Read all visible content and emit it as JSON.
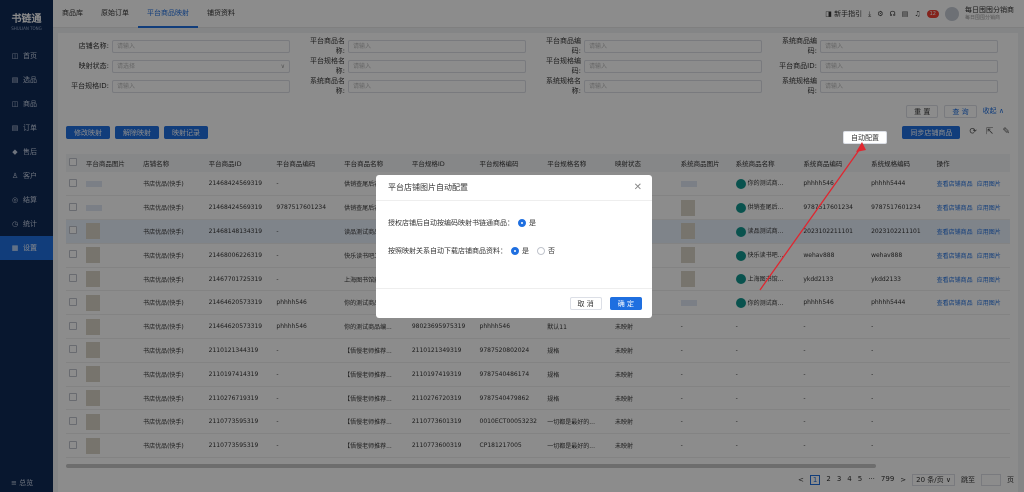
{
  "app": {
    "name": "书链通",
    "sub": "SHULIAN TONG"
  },
  "sidebar": {
    "items": [
      {
        "icon": "◫",
        "label": "首页"
      },
      {
        "icon": "▤",
        "label": "选品"
      },
      {
        "icon": "◫",
        "label": "商品"
      },
      {
        "icon": "▤",
        "label": "订单"
      },
      {
        "icon": "◆",
        "label": "售后"
      },
      {
        "icon": "♙",
        "label": "客户"
      },
      {
        "icon": "◎",
        "label": "结算"
      },
      {
        "icon": "◷",
        "label": "统计"
      },
      {
        "icon": "▦",
        "label": "设置"
      }
    ],
    "footer": "≡ 总览"
  },
  "topnav": {
    "tabs": [
      "商品库",
      "原始订单",
      "平台商品映射",
      "铺货资料"
    ]
  },
  "topright": {
    "guide": "新手指引",
    "badge": "12",
    "user_line1": "每日囤囤分销商",
    "user_line2": "每日囤囤分销商"
  },
  "filters": {
    "rows": [
      [
        {
          "label": "店铺名称:",
          "ph": "请输入"
        },
        {
          "label": "平台商品名称:",
          "ph": "请输入"
        },
        {
          "label": "平台商品编码:",
          "ph": "请输入"
        },
        {
          "label": "系统商品编码:",
          "ph": "请输入"
        }
      ],
      [
        {
          "label": "映射状态:",
          "ph": "请选择"
        },
        {
          "label": "平台规格名称:",
          "ph": "请输入"
        },
        {
          "label": "平台规格编码:",
          "ph": "请输入"
        },
        {
          "label": "平台商品ID:",
          "ph": "请输入"
        }
      ],
      [
        {
          "label": "平台规格ID:",
          "ph": "请输入"
        },
        {
          "label": "系统商品名称:",
          "ph": "请输入"
        },
        {
          "label": "系统规格名称:",
          "ph": "请输入"
        },
        {
          "label": "系统规格编码:",
          "ph": "请输入"
        }
      ]
    ],
    "reset": "重 置",
    "query": "查 询",
    "collapse": "收起 ∧"
  },
  "toolbar": {
    "edit_map": "修改映射",
    "remove_map": "解除映射",
    "map_log": "映射记录",
    "auto_config": "自动配置",
    "sync": "同步店铺商品"
  },
  "table": {
    "headers": [
      "",
      "平台商品图片",
      "店铺名称",
      "平台商品ID",
      "平台商品编码",
      "平台商品名称",
      "平台规格ID",
      "平台规格编码",
      "平台规格名称",
      "映射状态",
      "系统商品图片",
      "系统商品名称",
      "系统商品编码",
      "系统规格编码",
      "操作"
    ],
    "rows": [
      {
        "shop": "书店优品(快手)",
        "pid": "21468424569319",
        "pcode": "-",
        "pname": "供销查尾后农...",
        "sid": "",
        "scode": "",
        "sname": "",
        "status": "",
        "sysname": "你的测试商...",
        "syscode": "phhhh546",
        "sysspec": "phhhh5444",
        "ops": [
          "查看店铺商品",
          "应用图片"
        ]
      },
      {
        "shop": "书店优品(快手)",
        "pid": "21468424569319",
        "pcode": "9787517601234",
        "pname": "供销查尾后农...",
        "sid": "",
        "scode": "",
        "sname": "",
        "status": "",
        "sysname": "供销查尾后...",
        "syscode": "9787517601234",
        "sysspec": "9787517601234",
        "ops": [
          "查看店铺商品",
          "应用图片"
        ]
      },
      {
        "shop": "书店优品(快手)",
        "pid": "21468148134319",
        "pcode": "-",
        "pname": "读品测试商品...",
        "sid": "",
        "scode": "",
        "sname": "",
        "status": "",
        "sysname": "读品测试商...",
        "syscode": "2023102211101",
        "sysspec": "2023102211101",
        "ops": [
          "查看店铺商品",
          "应用图片"
        ]
      },
      {
        "shop": "书店优品(快手)",
        "pid": "21468006226319",
        "pcode": "-",
        "pname": "快乐读书吧二年...",
        "sid": "",
        "scode": "",
        "sname": "",
        "status": "",
        "sysname": "快乐读书吧...",
        "syscode": "wehav888",
        "sysspec": "wehav888",
        "ops": [
          "查看店铺商品",
          "应用图片"
        ]
      },
      {
        "shop": "书店优品(快手)",
        "pid": "21467701725319",
        "pcode": "-",
        "pname": "上海图书馆藏...",
        "sid": "",
        "scode": "",
        "sname": "",
        "status": "",
        "sysname": "上海图书馆...",
        "syscode": "ykdd2133",
        "sysspec": "ykdd2133",
        "ops": [
          "查看店铺商品",
          "应用图片"
        ]
      },
      {
        "shop": "书店优品(快手)",
        "pid": "21464620573319",
        "pcode": "phhhh546",
        "pname": "你的测试商品...",
        "sid": "",
        "scode": "",
        "sname": "",
        "status": "",
        "sysname": "你的测试商...",
        "syscode": "phhhh546",
        "sysspec": "phhhh5444",
        "ops": [
          "查看店铺商品",
          "应用图片"
        ]
      },
      {
        "shop": "书店优品(快手)",
        "pid": "21464620573319",
        "pcode": "phhhh546",
        "pname": "你的测试商品编...",
        "sid": "98023695975319",
        "scode": "phhhh546",
        "sname": "默认11",
        "status": "未映射",
        "sysname": "-",
        "syscode": "-",
        "sysspec": "-",
        "ops": []
      },
      {
        "shop": "书店优品(快手)",
        "pid": "2110121344319",
        "pcode": "-",
        "pname": "【悟慢老师推荐...",
        "sid": "2110121349319",
        "scode": "9787520802024",
        "sname": "规格",
        "status": "未映射",
        "sysname": "-",
        "syscode": "-",
        "sysspec": "-",
        "ops": []
      },
      {
        "shop": "书店优品(快手)",
        "pid": "2110197414319",
        "pcode": "-",
        "pname": "【悟慢老师推荐...",
        "sid": "2110197419319",
        "scode": "9787540486174",
        "sname": "规格",
        "status": "未映射",
        "sysname": "-",
        "syscode": "-",
        "sysspec": "-",
        "ops": []
      },
      {
        "shop": "书店优品(快手)",
        "pid": "2110276719319",
        "pcode": "-",
        "pname": "【悟慢老师推荐...",
        "sid": "2110276720319",
        "scode": "9787540479862",
        "sname": "规格",
        "status": "未映射",
        "sysname": "-",
        "syscode": "-",
        "sysspec": "-",
        "ops": []
      },
      {
        "shop": "书店优品(快手)",
        "pid": "2110773595319",
        "pcode": "-",
        "pname": "【悟慢老师推荐...",
        "sid": "2110773601319",
        "scode": "0010ECT00053232",
        "sname": "一切都是最好的...",
        "status": "未映射",
        "sysname": "-",
        "syscode": "-",
        "sysspec": "-",
        "ops": []
      },
      {
        "shop": "书店优品(快手)",
        "pid": "2110773595319",
        "pcode": "-",
        "pname": "【悟慢老师推荐...",
        "sid": "2110773600319",
        "scode": "CP181217005",
        "sname": "一切都是最好的...",
        "status": "未映射",
        "sysname": "-",
        "syscode": "-",
        "sysspec": "-",
        "ops": []
      }
    ]
  },
  "pagination": {
    "prev": "<",
    "pages": [
      "1",
      "2",
      "3",
      "4",
      "5",
      "···",
      "799"
    ],
    "next": ">",
    "size": "20 条/页 ∨",
    "goto": "跳至",
    "page_unit": "页"
  },
  "modal": {
    "title": "平台店铺图片自动配置",
    "close": "✕",
    "row1_label": "授权店铺后自动按编码映射书链通商品：",
    "row1_yes": "是",
    "row2_label": "按照映射关系自动下载店铺商品资料：",
    "row2_yes": "是",
    "row2_no": "否",
    "cancel": "取 消",
    "confirm": "确 定"
  }
}
